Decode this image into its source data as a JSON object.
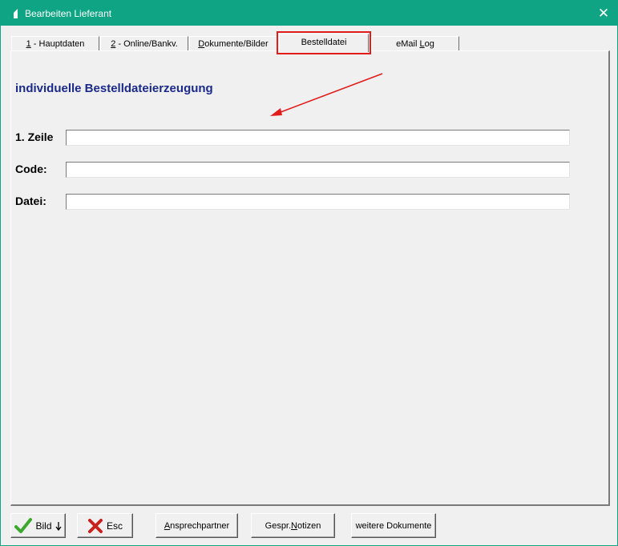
{
  "window": {
    "title": "Bearbeiten Lieferant"
  },
  "tabs": [
    {
      "key": "1",
      "label": " - Hauptdaten"
    },
    {
      "key": "2",
      "label": " - Online/Bankv."
    },
    {
      "key": "D",
      "label": "okumente/Bilder"
    },
    {
      "key": "",
      "label": "Bestelldatei"
    },
    {
      "prefix": "eMail ",
      "key": "L",
      "label": "og"
    }
  ],
  "main": {
    "heading": "individuelle Bestelldateierzeugung",
    "fields": [
      {
        "label": "1. Zeile",
        "value": ""
      },
      {
        "label": "Code:",
        "value": ""
      },
      {
        "label": "Datei:",
        "value": ""
      }
    ]
  },
  "buttons": {
    "bild": "Bild",
    "esc": "Esc",
    "ansprechpartner_key": "A",
    "ansprechpartner_rest": "nsprechpartner",
    "notizen_prefix": "Gespr.",
    "notizen_key": "N",
    "notizen_rest": "otizen",
    "weitere": "weitere Dokumente"
  },
  "colors": {
    "titlebar": "#0fa584",
    "heading": "#1b2a8a",
    "highlight": "#e21b1b"
  }
}
